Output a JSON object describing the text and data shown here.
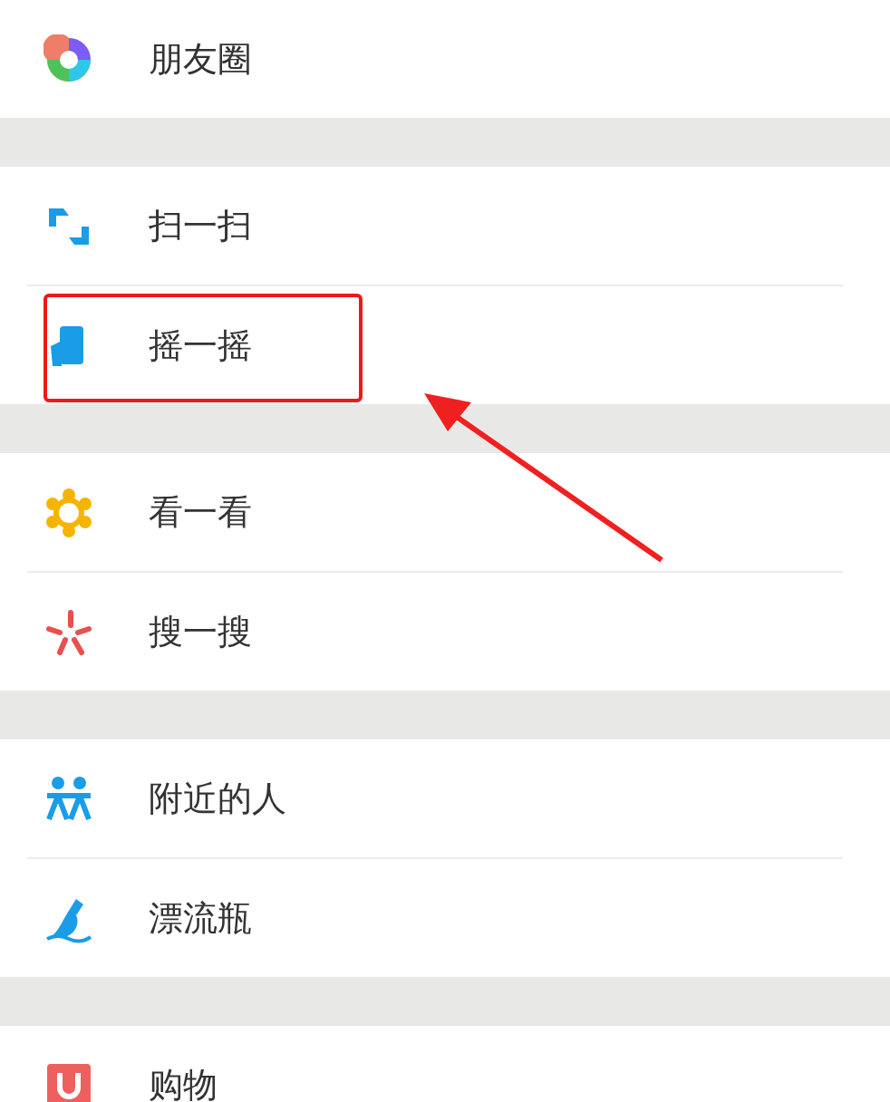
{
  "groups": [
    {
      "items": [
        {
          "label": "朋友圈",
          "highlighted": false
        }
      ]
    },
    {
      "items": [
        {
          "label": "扫一扫",
          "highlighted": false
        },
        {
          "label": "摇一摇",
          "highlighted": true
        }
      ]
    },
    {
      "items": [
        {
          "label": "看一看",
          "highlighted": false
        },
        {
          "label": "搜一搜",
          "highlighted": false
        }
      ]
    },
    {
      "items": [
        {
          "label": "附近的人",
          "highlighted": false
        },
        {
          "label": "漂流瓶",
          "highlighted": false
        }
      ]
    },
    {
      "items": [
        {
          "label": "购物",
          "highlighted": false
        }
      ]
    }
  ]
}
